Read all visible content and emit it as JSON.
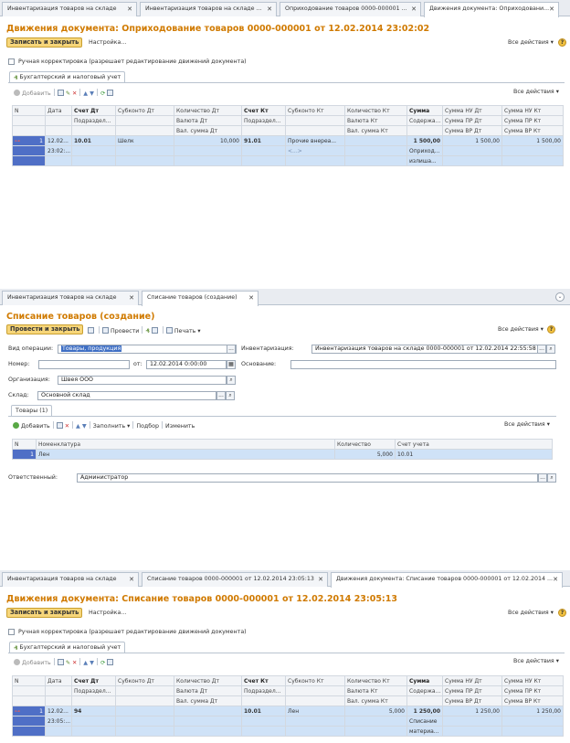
{
  "panel1": {
    "tabs": [
      "Инвентаризация товаров на складе",
      "Инвентаризация товаров на складе ...",
      "Оприходование товаров 0000-000001 ...",
      "Движения документа: Оприходовани..."
    ],
    "title": "Движения документа: Оприходование товаров 0000-000001 от 12.02.2014 23:02:02",
    "save_close": "Записать и закрыть",
    "settings": "Настройка...",
    "all_actions": "Все действия ▾",
    "manual_label": "Ручная корректировка (разрешает редактирование движений документа)",
    "subtab": "Бухгалтерский и налоговый учет",
    "add": "Добавить",
    "grid_all_actions": "Все действия ▾",
    "headers": {
      "row1": [
        "N",
        "Дата",
        "Счет Дт",
        "Субконто Дт",
        "Количество Дт",
        "Счет Кт",
        "Субконто Кт",
        "Количество Кт",
        "Сумма",
        "Сумма НУ Дт",
        "Сумма НУ Кт"
      ],
      "row2": [
        "Подраздел...",
        "Валюта Дт",
        "Подраздел...",
        "Валюта Кт",
        "Содержа...",
        "Сумма ПР Дт",
        "Сумма ПР Кт"
      ],
      "row3": [
        "Вал. сумма Дт",
        "Вал. сумма Кт",
        "Сумма ВР Дт",
        "Сумма ВР Кт"
      ]
    },
    "row": {
      "n": "1",
      "date1": "12.02...",
      "date2": "23:02:...",
      "account_dt": "10.01",
      "subconto_dt": "Шелк",
      "qty_dt": "10,000",
      "account_kt": "91.01",
      "subconto_kt": "Прочие внереа...",
      "subconto_kt2": "<...>",
      "sum": "1 500,00",
      "content1": "Оприход...",
      "content2": "излиша...",
      "sum_nu_dt": "1 500,00",
      "sum_nu_kt": "1 500,00"
    }
  },
  "panel2": {
    "tabs": [
      "Инвентаризация товаров на складе",
      "Списание товаров (создание)"
    ],
    "title": "Списание товаров (создание)",
    "post_close": "Провести и закрыть",
    "post": "Провести",
    "print": "Печать ▾",
    "all_actions": "Все действия ▾",
    "labels": {
      "operation": "Вид операции:",
      "number": "Номер:",
      "from": "от:",
      "org": "Организация:",
      "warehouse": "Склад:",
      "inventory": "Инвентаризация:",
      "basis": "Основание:",
      "responsible": "Ответственный:"
    },
    "values": {
      "operation": "Товары, продукция",
      "number": "",
      "date": "12.02.2014  0:00:00",
      "org": "Швея ООО",
      "warehouse": "Основной склад",
      "inventory": "Инвентаризация товаров на складе 0000-000001 от 12.02.2014 22:55:58",
      "basis": "",
      "responsible": "Администратор"
    },
    "goods_tab": "Товары (1)",
    "add": "Добавить",
    "fill": "Заполнить ▾",
    "pick": "Подбор",
    "change": "Изменить",
    "grid_all_actions": "Все действия ▾",
    "headers": [
      "N",
      "Номенклатура",
      "Количество",
      "Счет учета"
    ],
    "row": {
      "n": "1",
      "item": "Лен",
      "qty": "5,000",
      "account": "10.01"
    }
  },
  "panel3": {
    "tabs": [
      "Инвентаризация товаров на складе",
      "Списание товаров 0000-000001 от 12.02.2014 23:05:13",
      "Движения документа: Списание товаров 0000-000001 от 12.02.2014 ..."
    ],
    "title": "Движения документа: Списание товаров 0000-000001 от 12.02.2014 23:05:13",
    "save_close": "Записать и закрыть",
    "settings": "Настройка...",
    "all_actions": "Все действия ▾",
    "manual_label": "Ручная корректировка (разрешает редактирование движений документа)",
    "subtab": "Бухгалтерский и налоговый учет",
    "add": "Добавить",
    "grid_all_actions": "Все действия ▾",
    "headers": {
      "row1": [
        "N",
        "Дата",
        "Счет Дт",
        "Субконто Дт",
        "Количество Дт",
        "Счет Кт",
        "Субконто Кт",
        "Количество Кт",
        "Сумма",
        "Сумма НУ Дт",
        "Сумма НУ Кт"
      ],
      "row2": [
        "Подраздел...",
        "Валюта Дт",
        "Подраздел...",
        "Валюта Кт",
        "Содержа...",
        "Сумма ПР Дт",
        "Сумма ПР Кт"
      ],
      "row3": [
        "Вал. сумма Дт",
        "Вал. сумма Кт",
        "Сумма ВР Дт",
        "Сумма ВР Кт"
      ]
    },
    "row": {
      "n": "1",
      "date1": "12.02...",
      "date2": "23:05:...",
      "account_dt": "94",
      "account_kt": "10.01",
      "subconto_kt": "Лен",
      "qty_kt": "5,000",
      "sum": "1 250,00",
      "content1": "Списание",
      "content2": "материа...",
      "sum_nu_dt": "1 250,00",
      "sum_nu_kt": "1 250,00"
    }
  }
}
